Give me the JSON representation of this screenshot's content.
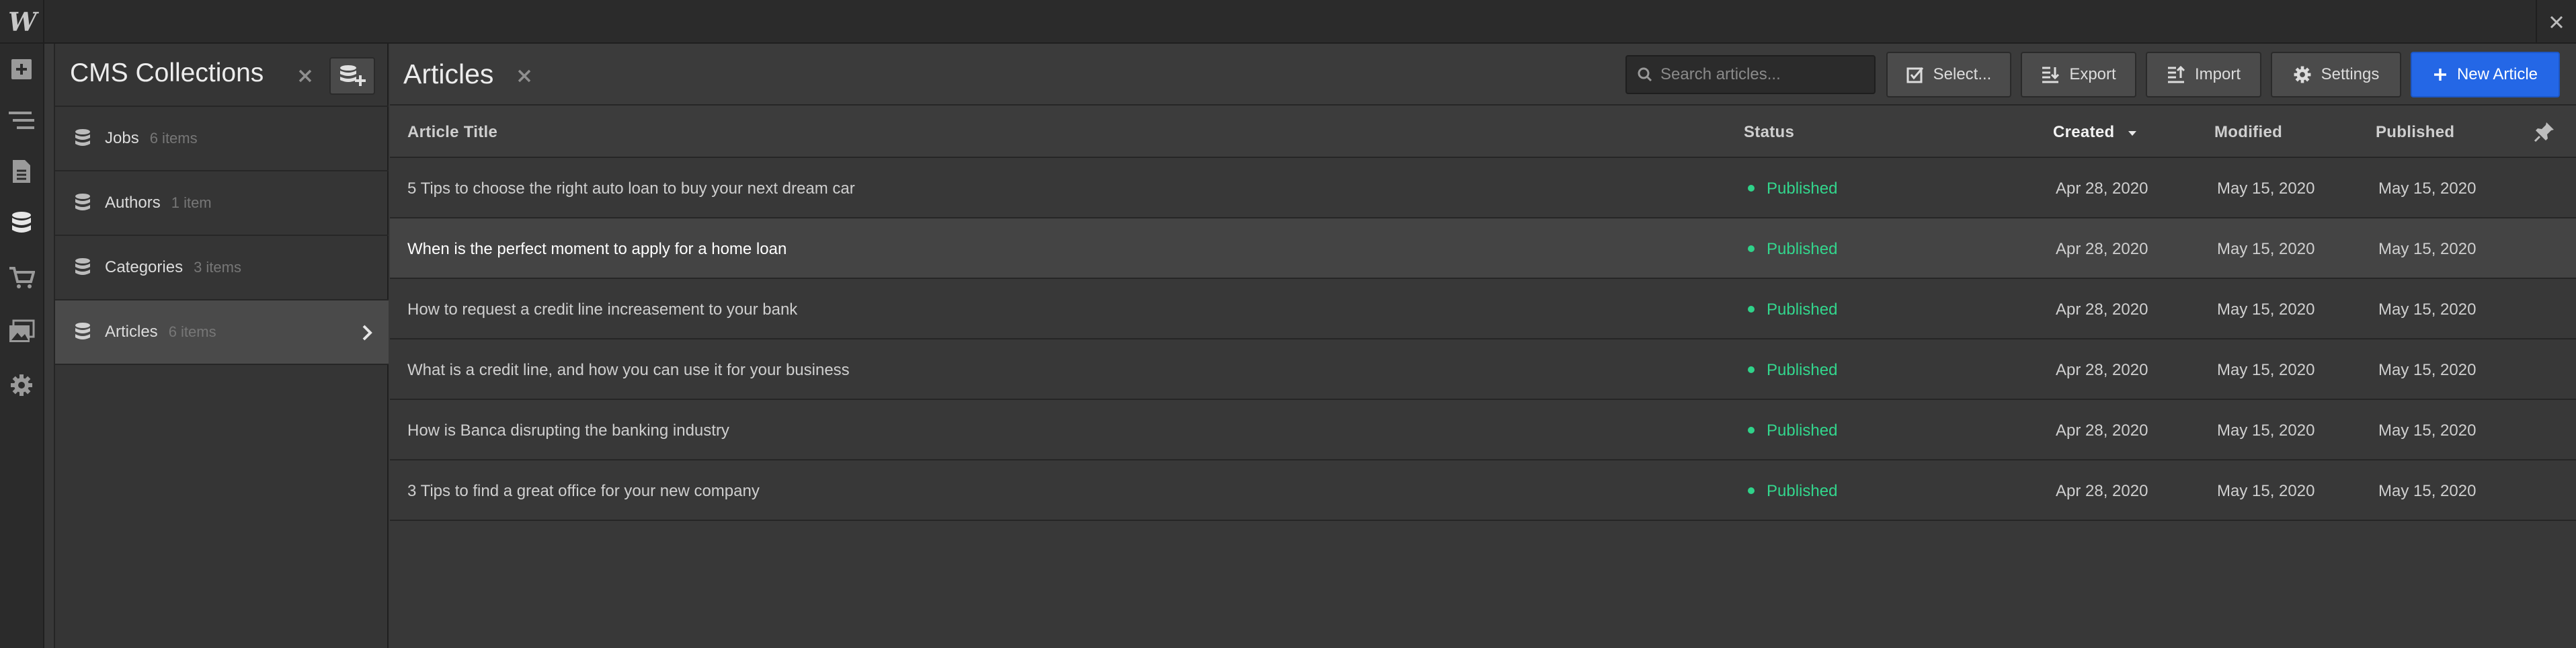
{
  "app": {
    "logo_text": "W",
    "colors": {
      "accent": "#2467e6",
      "published": "#33d68d",
      "background": "#383838"
    }
  },
  "left_toolbar": {
    "items": [
      {
        "name": "add-panel",
        "icon": "plus-square-icon"
      },
      {
        "name": "navigator",
        "icon": "navigator-icon"
      },
      {
        "name": "pages",
        "icon": "page-icon"
      },
      {
        "name": "cms",
        "icon": "database-icon",
        "active": true
      },
      {
        "name": "ecommerce",
        "icon": "cart-icon"
      },
      {
        "name": "assets",
        "icon": "images-icon"
      },
      {
        "name": "settings",
        "icon": "gear-icon"
      }
    ]
  },
  "collections": {
    "title": "CMS Collections",
    "items": [
      {
        "name": "Jobs",
        "count": "6 items"
      },
      {
        "name": "Authors",
        "count": "1 item"
      },
      {
        "name": "Categories",
        "count": "3 items"
      },
      {
        "name": "Articles",
        "count": "6 items",
        "active": true
      }
    ]
  },
  "main": {
    "title": "Articles",
    "search": {
      "placeholder": "Search articles..."
    },
    "toolbar": {
      "select_label": "Select...",
      "export_label": "Export",
      "import_label": "Import",
      "settings_label": "Settings",
      "new_label": "New Article"
    },
    "columns": {
      "title": "Article Title",
      "status": "Status",
      "created": "Created",
      "modified": "Modified",
      "published": "Published"
    },
    "sorted_column": "created",
    "rows": [
      {
        "title": "5 Tips to choose the right auto loan to buy your next dream car",
        "status": "Published",
        "created": "Apr 28, 2020",
        "modified": "May 15, 2020",
        "published": "May 15, 2020"
      },
      {
        "title": "When is the perfect moment to apply for a home loan",
        "status": "Published",
        "created": "Apr 28, 2020",
        "modified": "May 15, 2020",
        "published": "May 15, 2020",
        "hover": true
      },
      {
        "title": "How to request a credit line increasement to your bank",
        "status": "Published",
        "created": "Apr 28, 2020",
        "modified": "May 15, 2020",
        "published": "May 15, 2020"
      },
      {
        "title": "What is a credit line, and how you can use it for your business",
        "status": "Published",
        "created": "Apr 28, 2020",
        "modified": "May 15, 2020",
        "published": "May 15, 2020"
      },
      {
        "title": "How is Banca disrupting the banking industry",
        "status": "Published",
        "created": "Apr 28, 2020",
        "modified": "May 15, 2020",
        "published": "May 15, 2020"
      },
      {
        "title": "3 Tips to find a great office for your new company",
        "status": "Published",
        "created": "Apr 28, 2020",
        "modified": "May 15, 2020",
        "published": "May 15, 2020"
      }
    ]
  }
}
